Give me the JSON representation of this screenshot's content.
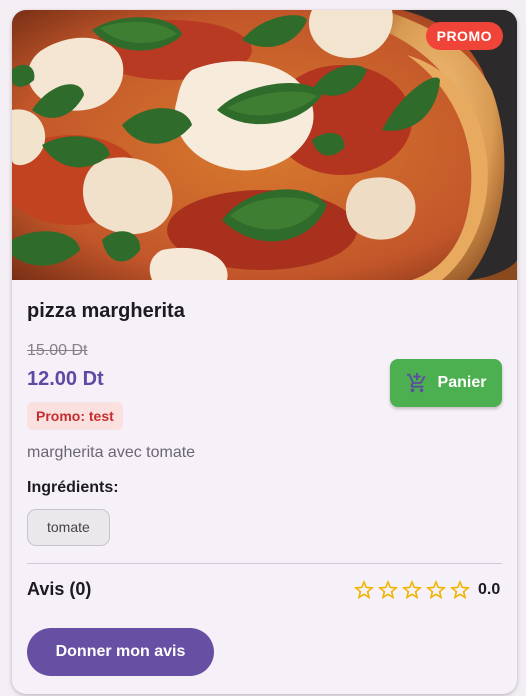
{
  "product": {
    "badge": "PROMO",
    "name": "pizza margherita",
    "old_price": "15.00 Dt",
    "price": "12.00 Dt",
    "promo_label": "Promo: test",
    "description": "margherita avec tomate",
    "ingredients_title": "Ingrédients:",
    "ingredients": [
      "tomate"
    ]
  },
  "actions": {
    "cart_label": "Panier",
    "cart_icon": "add-shopping-cart-icon",
    "review_label": "Donner mon avis"
  },
  "reviews": {
    "title": "Avis (0)",
    "stars_filled": 0,
    "stars_total": 5,
    "rating": "0.0",
    "star_icon": "star-outline-icon"
  },
  "colors": {
    "badge": "#f04438",
    "price": "#5d4ba3",
    "cart_button": "#4caf50",
    "review_button": "#6750a4",
    "star": "#f0b400",
    "promo_tag_bg": "#fbe0e0",
    "promo_tag_text": "#c62f2f"
  }
}
